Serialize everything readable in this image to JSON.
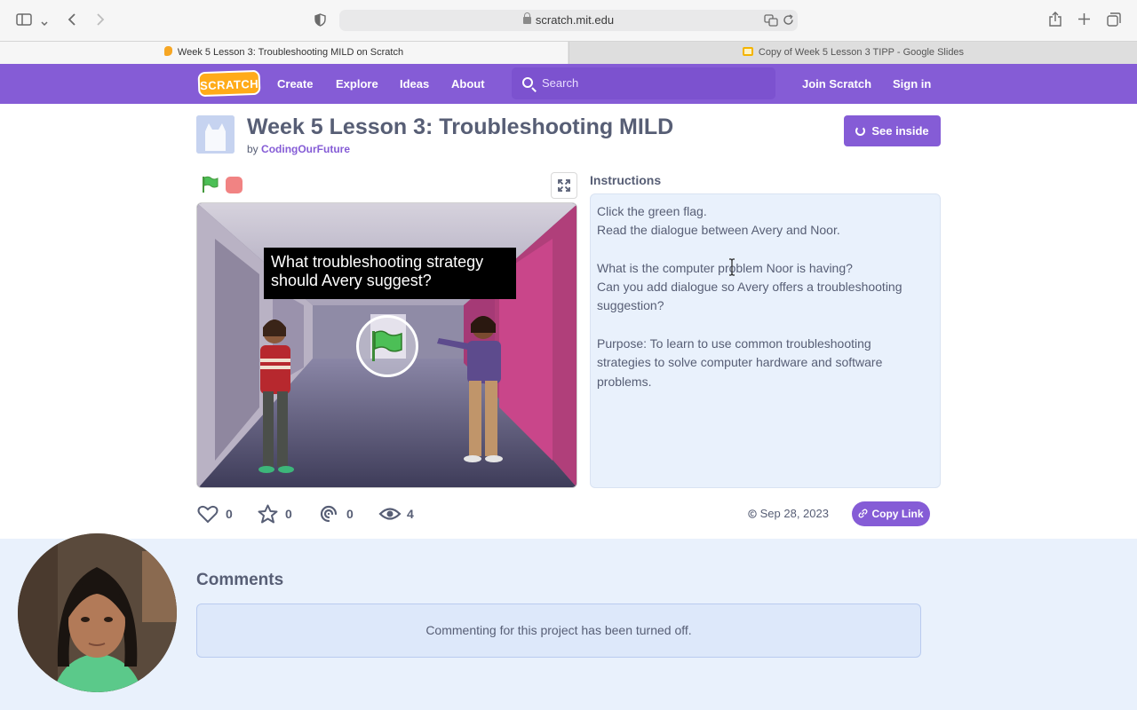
{
  "browser": {
    "url": "scratch.mit.edu",
    "tabs": [
      {
        "title": "Week 5 Lesson 3: Troubleshooting MILD on Scratch",
        "active": true
      },
      {
        "title": "Copy of Week 5 Lesson 3 TIPP - Google Slides",
        "active": false
      }
    ]
  },
  "nav": {
    "logo": "SCRATCH",
    "links": [
      "Create",
      "Explore",
      "Ideas",
      "About"
    ],
    "search_placeholder": "Search",
    "join": "Join Scratch",
    "signin": "Sign in"
  },
  "project": {
    "title": "Week 5 Lesson 3: Troubleshooting MILD",
    "by_prefix": "by",
    "author": "CodingOurFuture",
    "see_inside": "See inside",
    "stage_caption": "What troubleshooting strategy should Avery suggest?"
  },
  "instructions": {
    "heading": "Instructions",
    "lines": [
      "Click the green flag.",
      "Read the dialogue between Avery and Noor.",
      "",
      "What is the computer problem Noor is having?",
      "Can you add dialogue so Avery offers a troubleshooting",
      "suggestion?",
      "",
      "Purpose: To learn to use common troubleshooting",
      "strategies to solve computer hardware and software",
      "problems."
    ]
  },
  "stats": {
    "loves": "0",
    "favorites": "0",
    "remixes": "0",
    "views": "4",
    "share_date": "Sep 28, 2023",
    "copy_link": "Copy Link"
  },
  "comments": {
    "title": "Comments",
    "off_message": "Commenting for this project has been turned off."
  },
  "colors": {
    "scratch_purple": "#855cd6",
    "scratch_orange": "#ffab19",
    "text": "#575e75",
    "panel_blue": "#e9f1fc"
  }
}
